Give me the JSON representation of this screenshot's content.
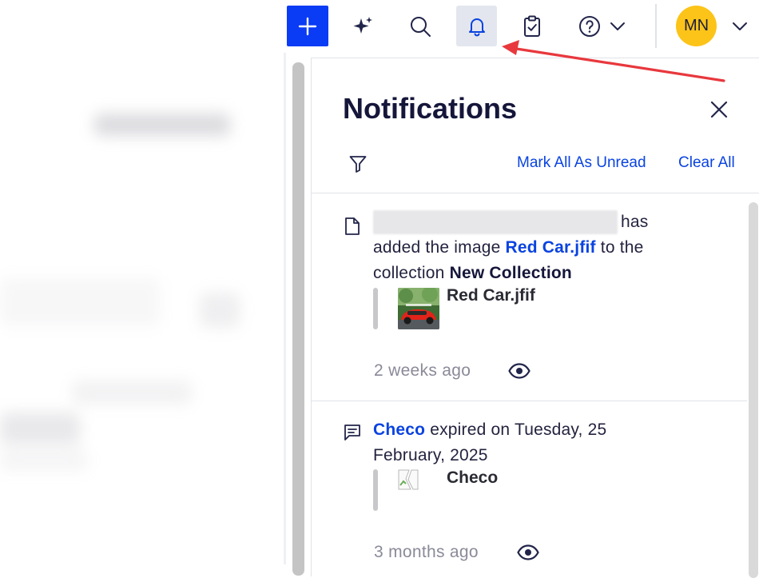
{
  "topbar": {
    "icons": {
      "add": "plus-icon",
      "ai": "sparkle-icon",
      "search": "search-icon",
      "notifications": "bell-icon",
      "tasks": "clipboard-check-icon",
      "help": "help-circle-icon",
      "account_menu": "chevron-down-icon"
    },
    "avatar_initials": "MN",
    "colors": {
      "add_button": "#0a3bf5",
      "avatar": "#fcc419",
      "active_bg": "#e3e6ee"
    }
  },
  "panel": {
    "title": "Notifications",
    "mark_all_unread": "Mark All As Unread",
    "clear_all": "Clear All",
    "link_color": "#0a43e0"
  },
  "notifications": [
    {
      "icon": "document-icon",
      "suffix_text": "has",
      "text_before_link": "added the image ",
      "link_text": "Red Car.jfif",
      "text_after_link": " to the collection ",
      "collection": "New Collection",
      "attachment_name": "Red Car.jfif",
      "time": "2 weeks ago"
    },
    {
      "icon": "comment-icon",
      "link_text": "Checo",
      "text_after_link": " expired on Tuesday, 25 February, 2025",
      "attachment_name": "Checo",
      "time": "3 months ago"
    }
  ],
  "annotation": {
    "arrow_color": "#e8383d"
  }
}
